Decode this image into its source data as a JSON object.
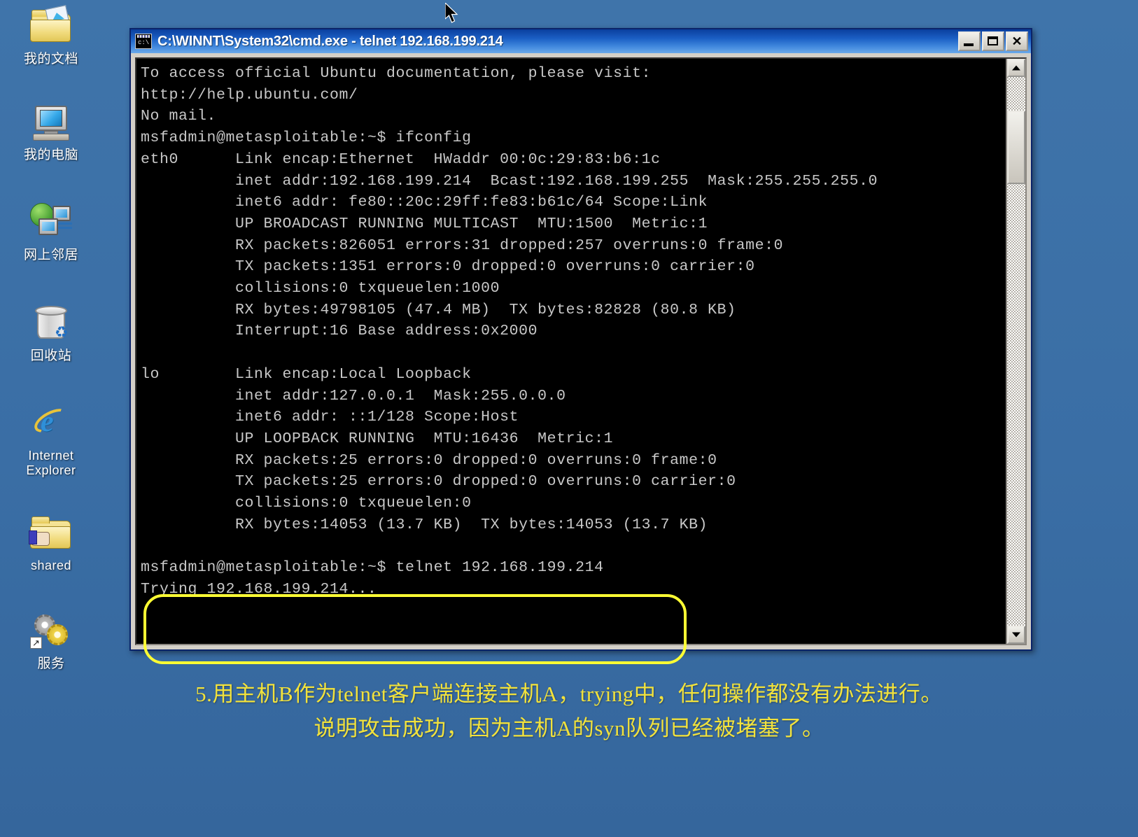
{
  "desktop": {
    "background_color": "#3a6ea5",
    "icons": [
      {
        "name": "my-documents",
        "label": "我的文档",
        "icon": "folder-document-icon"
      },
      {
        "name": "my-computer",
        "label": "我的电脑",
        "icon": "computer-monitor-icon"
      },
      {
        "name": "network-neighborhood",
        "label": "网上邻居",
        "icon": "network-globe-icon"
      },
      {
        "name": "recycle-bin",
        "label": "回收站",
        "icon": "recycle-bin-icon"
      },
      {
        "name": "internet-explorer",
        "label": "Internet Explorer",
        "icon": "internet-explorer-icon"
      },
      {
        "name": "shared-folder",
        "label": "shared",
        "icon": "shared-folder-hand-icon"
      },
      {
        "name": "services",
        "label": "服务",
        "icon": "gears-shortcut-icon"
      }
    ]
  },
  "window": {
    "title": "C:\\WINNT\\System32\\cmd.exe - telnet 192.168.199.214",
    "icon": "cmd-console-icon",
    "buttons": {
      "minimize": "minimize-button",
      "maximize": "maximize-button",
      "close": "close-button",
      "close_glyph": "✕"
    },
    "scrollbar": {
      "up_arrow": "scroll-up-arrow",
      "down_arrow": "scroll-down-arrow",
      "thumb": "scroll-thumb"
    }
  },
  "terminal": {
    "foreground_color": "#c8c8c8",
    "background_color": "#000000",
    "highlight_color": "#ffff33",
    "text": "To access official Ubuntu documentation, please visit:\nhttp://help.ubuntu.com/\nNo mail.\nmsfadmin@metasploitable:~$ ifconfig\neth0      Link encap:Ethernet  HWaddr 00:0c:29:83:b6:1c\n          inet addr:192.168.199.214  Bcast:192.168.199.255  Mask:255.255.255.0\n          inet6 addr: fe80::20c:29ff:fe83:b61c/64 Scope:Link\n          UP BROADCAST RUNNING MULTICAST  MTU:1500  Metric:1\n          RX packets:826051 errors:31 dropped:257 overruns:0 frame:0\n          TX packets:1351 errors:0 dropped:0 overruns:0 carrier:0\n          collisions:0 txqueuelen:1000\n          RX bytes:49798105 (47.4 MB)  TX bytes:82828 (80.8 KB)\n          Interrupt:16 Base address:0x2000\n\nlo        Link encap:Local Loopback\n          inet addr:127.0.0.1  Mask:255.0.0.0\n          inet6 addr: ::1/128 Scope:Host\n          UP LOOPBACK RUNNING  MTU:16436  Metric:1\n          RX packets:25 errors:0 dropped:0 overruns:0 frame:0\n          TX packets:25 errors:0 dropped:0 overruns:0 carrier:0\n          collisions:0 txqueuelen:0\n          RX bytes:14053 (13.7 KB)  TX bytes:14053 (13.7 KB)\n\nmsfadmin@metasploitable:~$ telnet 192.168.199.214\nTrying 192.168.199.214..."
  },
  "caption": {
    "color": "#f2e23c",
    "line1": "5.用主机B作为telnet客户端连接主机A，trying中，任何操作都没有办法进行。",
    "line2": "说明攻击成功，因为主机A的syn队列已经被堵塞了。"
  }
}
